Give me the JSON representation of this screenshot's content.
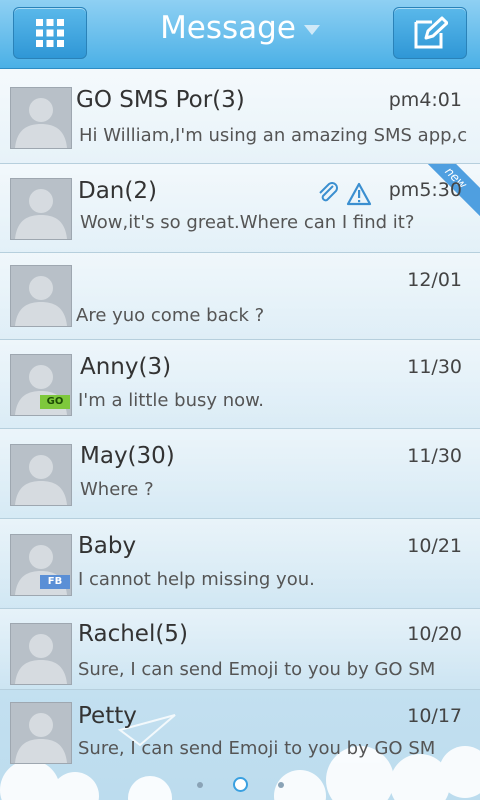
{
  "header": {
    "title": "Message"
  },
  "messages": [
    {
      "name": "GO SMS Por(3)",
      "time": "pm4:01",
      "snippet": "Hi William,I'm using an amazing SMS app,c",
      "badge": "",
      "flag": ""
    },
    {
      "name": "Dan(2)",
      "time": "pm5:30",
      "snippet": "Wow,it's so great.Where can I find it?",
      "badge": "",
      "flag": "new"
    },
    {
      "name": "",
      "time": "12/01",
      "snippet": "Are yuo come back ?",
      "badge": "",
      "flag": ""
    },
    {
      "name": "Anny(3)",
      "time": "11/30",
      "snippet": "I'm a little busy now.",
      "badge": "GO",
      "flag": ""
    },
    {
      "name": "May(30)",
      "time": "11/30",
      "snippet": "Where ?",
      "badge": "",
      "flag": ""
    },
    {
      "name": "Baby",
      "time": "10/21",
      "snippet": "I cannot help missing you.",
      "badge": "FB",
      "flag": ""
    },
    {
      "name": "Rachel(5)",
      "time": "10/20",
      "snippet": "Sure, I can send Emoji to you by GO SM",
      "badge": "",
      "flag": ""
    },
    {
      "name": "Petty",
      "time": "10/17",
      "snippet": "Sure, I can send Emoji to you by GO SM",
      "badge": "",
      "flag": ""
    }
  ],
  "icons": {
    "menu": "grid-icon",
    "compose": "compose-icon",
    "attachment": "paperclip-icon",
    "warning": "warning-icon",
    "avatar": "person-icon"
  },
  "pager": {
    "pages": 3,
    "current": 2
  },
  "colors": {
    "header": "#4bb0e6",
    "accent": "#3aa0e0",
    "badge_go": "#7ec83c",
    "badge_fb": "#5a8fd6"
  }
}
